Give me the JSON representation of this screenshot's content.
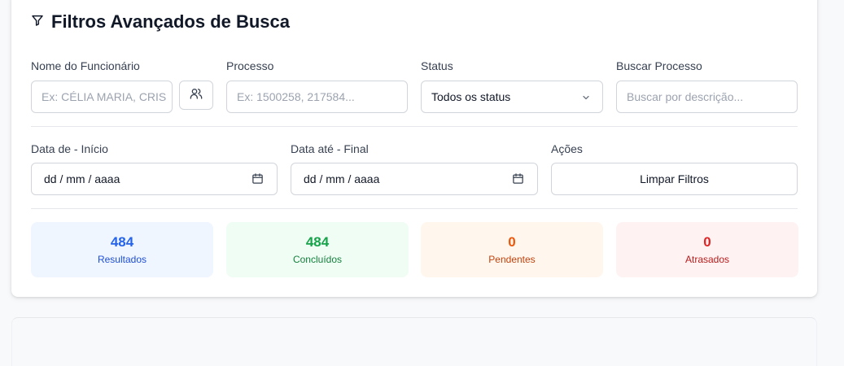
{
  "header": {
    "title": "Filtros Avançados de Busca",
    "icon": "filter-icon"
  },
  "filters": {
    "employee": {
      "label": "Nome do Funcionário",
      "placeholder": "Ex: CÉLIA MARIA, CRIS",
      "icon_button": "users-icon"
    },
    "process": {
      "label": "Processo",
      "placeholder": "Ex: 1500258, 217584..."
    },
    "status": {
      "label": "Status",
      "value": "Todos os status"
    },
    "search": {
      "label": "Buscar Processo",
      "placeholder": "Buscar por descrição..."
    },
    "date_from": {
      "label": "Data de - Início",
      "value": "dd / mm / aaaa"
    },
    "date_to": {
      "label": "Data até - Final",
      "value": "dd / mm / aaaa"
    },
    "actions": {
      "label": "Ações",
      "clear_button": "Limpar Filtros"
    }
  },
  "stats": [
    {
      "value": "484",
      "label": "Resultados",
      "color": "#2563eb",
      "bg": "#eff6ff",
      "labelColor": "#1d4ed8"
    },
    {
      "value": "484",
      "label": "Concluídos",
      "color": "#16a34a",
      "bg": "#f0fdf4",
      "labelColor": "#15803d"
    },
    {
      "value": "0",
      "label": "Pendentes",
      "color": "#ea580c",
      "bg": "#fff7ed",
      "labelColor": "#c2410c"
    },
    {
      "value": "0",
      "label": "Atrasados",
      "color": "#dc2626",
      "bg": "#fef2f2",
      "labelColor": "#b91c1c"
    }
  ]
}
